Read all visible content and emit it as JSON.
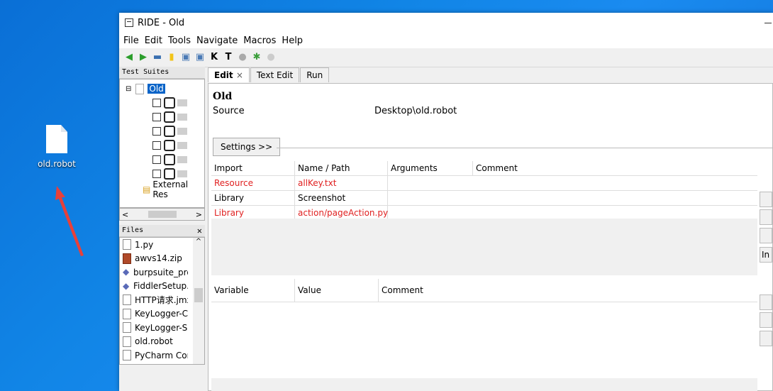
{
  "desktop": {
    "icon_label": "old.robot"
  },
  "window": {
    "title": "RIDE - Old"
  },
  "menu": [
    "File",
    "Edit",
    "Tools",
    "Navigate",
    "Macros",
    "Help"
  ],
  "toolbar_icons": [
    "back-arrow-icon",
    "forward-arrow-icon",
    "open-folder-icon",
    "new-file-icon",
    "save-icon",
    "save-all-icon",
    "keyword-icon",
    "text-icon",
    "run-icon",
    "debug-icon",
    "stop-icon"
  ],
  "test_suites": {
    "header": "Test Suites",
    "root": "Old",
    "children_count": 6,
    "external": "External Res"
  },
  "files": {
    "header": "Files",
    "items": [
      {
        "name": "1.py",
        "icon": "text-file-icon"
      },
      {
        "name": "awvs14.zip",
        "icon": "zip-icon"
      },
      {
        "name": "burpsuite_pro",
        "icon": "installer-icon"
      },
      {
        "name": "FiddlerSetup.",
        "icon": "installer-icon"
      },
      {
        "name": "HTTP请求.jmx",
        "icon": "text-file-icon"
      },
      {
        "name": "KeyLogger-C",
        "icon": "text-file-icon"
      },
      {
        "name": "KeyLogger-S",
        "icon": "text-file-icon"
      },
      {
        "name": "old.robot",
        "icon": "text-file-icon"
      },
      {
        "name": "PyCharm Cor",
        "icon": "text-file-icon"
      }
    ]
  },
  "tabs": [
    {
      "label": "Edit",
      "active": true
    },
    {
      "label": "Text Edit"
    },
    {
      "label": "Run"
    }
  ],
  "editor": {
    "suite_name": "Old",
    "source_label": "Source",
    "source_value": "Desktop\\old.robot",
    "settings_button": "Settings >>",
    "import_headers": [
      "Import",
      "Name / Path",
      "Arguments",
      "Comment"
    ],
    "imports": [
      {
        "type": "Resource",
        "path": "allKey.txt",
        "error": true
      },
      {
        "type": "Library",
        "path": "Screenshot",
        "error": false
      },
      {
        "type": "Library",
        "path": "action/pageAction.py",
        "error": true
      }
    ],
    "variable_headers": [
      "Variable",
      "Value",
      "Comment"
    ],
    "side_button_label": "In"
  }
}
